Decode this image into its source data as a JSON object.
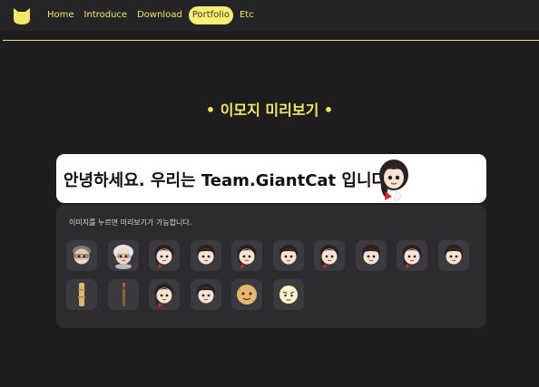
{
  "nav": {
    "items": [
      {
        "label": "Home",
        "active": false
      },
      {
        "label": "Introduce",
        "active": false
      },
      {
        "label": "Download",
        "active": false
      },
      {
        "label": "Portfolio",
        "active": true
      },
      {
        "label": "Etc",
        "active": false
      }
    ]
  },
  "section_title": "• 이모지 미리보기 •",
  "preview": {
    "text": "안녕하세요. 우리는 Team.GiantCat 입니다."
  },
  "panel": {
    "hint": "이미지를 누르면 미리보기가 가능합니다."
  },
  "emojis": [
    {
      "icon": "grandfather-emoji-icon"
    },
    {
      "icon": "grandmother-emoji-icon"
    },
    {
      "icon": "girl-red-bow-emoji-icon"
    },
    {
      "icon": "boy-emoji-icon"
    },
    {
      "icon": "girl-red-bow-emoji-icon"
    },
    {
      "icon": "boy-emoji-icon"
    },
    {
      "icon": "girl-red-bow-emoji-icon"
    },
    {
      "icon": "boy-emoji-icon"
    },
    {
      "icon": "girl-red-bow-emoji-icon"
    },
    {
      "icon": "boy-emoji-icon"
    },
    {
      "icon": "bamboo-stick-emoji-icon"
    },
    {
      "icon": "wooden-stick-emoji-icon"
    },
    {
      "icon": "girl-red-bow-emoji-icon"
    },
    {
      "icon": "boy-emoji-icon"
    },
    {
      "icon": "cookie-face-emoji-icon"
    },
    {
      "icon": "angry-face-emoji-icon"
    }
  ],
  "colors": {
    "accent": "#f2e66a",
    "background": "#1d1d1f",
    "panel": "#2c2c2f",
    "tile": "#3b3b3f"
  }
}
